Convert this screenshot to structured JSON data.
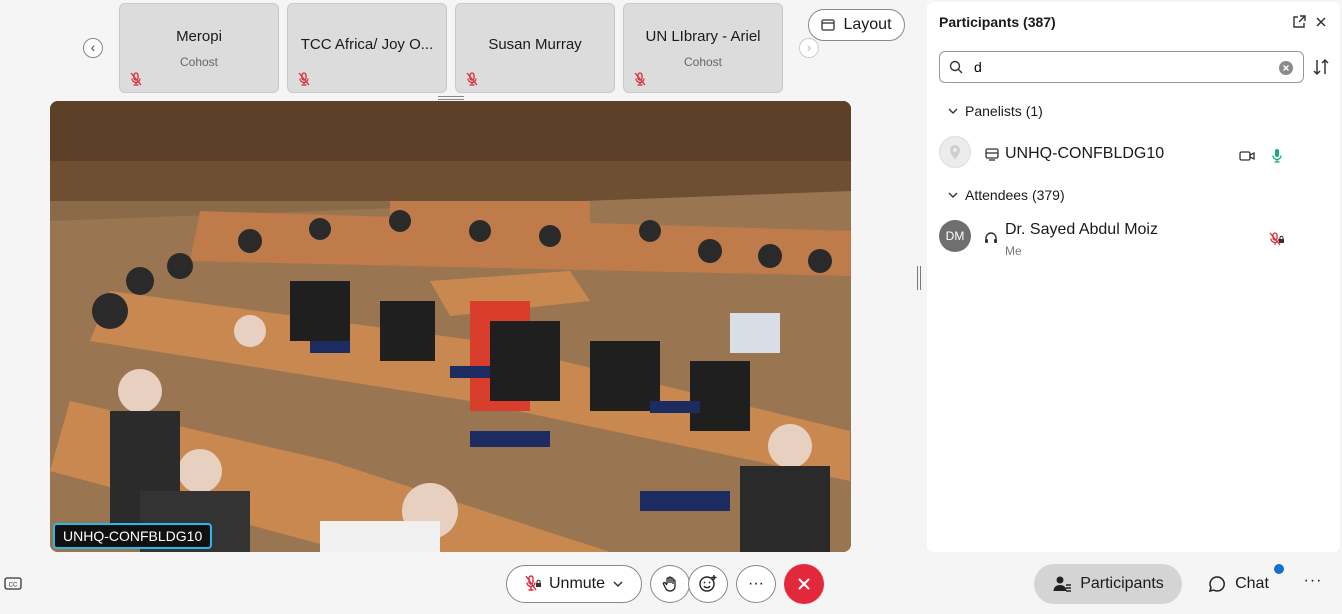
{
  "stage": {
    "tiles": [
      {
        "name": "Meropi",
        "role": "Cohost",
        "muted": true
      },
      {
        "name": "TCC Africa/ Joy O...",
        "role": "",
        "muted": true
      },
      {
        "name": "Susan Murray",
        "role": "",
        "muted": true
      },
      {
        "name": "UN LIbrary - Ariel",
        "role": "Cohost",
        "muted": true
      }
    ],
    "layout_label": "Layout",
    "active_speaker_label": "UNHQ-CONFBLDG10"
  },
  "participants_panel": {
    "title": "Participants (387)",
    "search_value": "d",
    "search_placeholder": "Search",
    "panelists": {
      "label": "Panelists (1)",
      "items": [
        {
          "name": "UNHQ-CONFBLDG10",
          "status": "unmuted"
        }
      ]
    },
    "attendees": {
      "label": "Attendees (379)",
      "items": [
        {
          "initials": "DM",
          "name": "Dr. Sayed Abdul Moiz",
          "sub": "Me",
          "status": "muted-locked"
        }
      ]
    }
  },
  "controls": {
    "unmute_label": "Unmute",
    "more_label": "···",
    "participants_label": "Participants",
    "chat_label": "Chat",
    "chat_unread": true
  },
  "colors": {
    "end_call": "#e3283c",
    "mic_muted": "#d92d3b",
    "mic_active": "#1ea87d",
    "speaker_border": "#2bb8e6",
    "notification": "#1170cf"
  }
}
